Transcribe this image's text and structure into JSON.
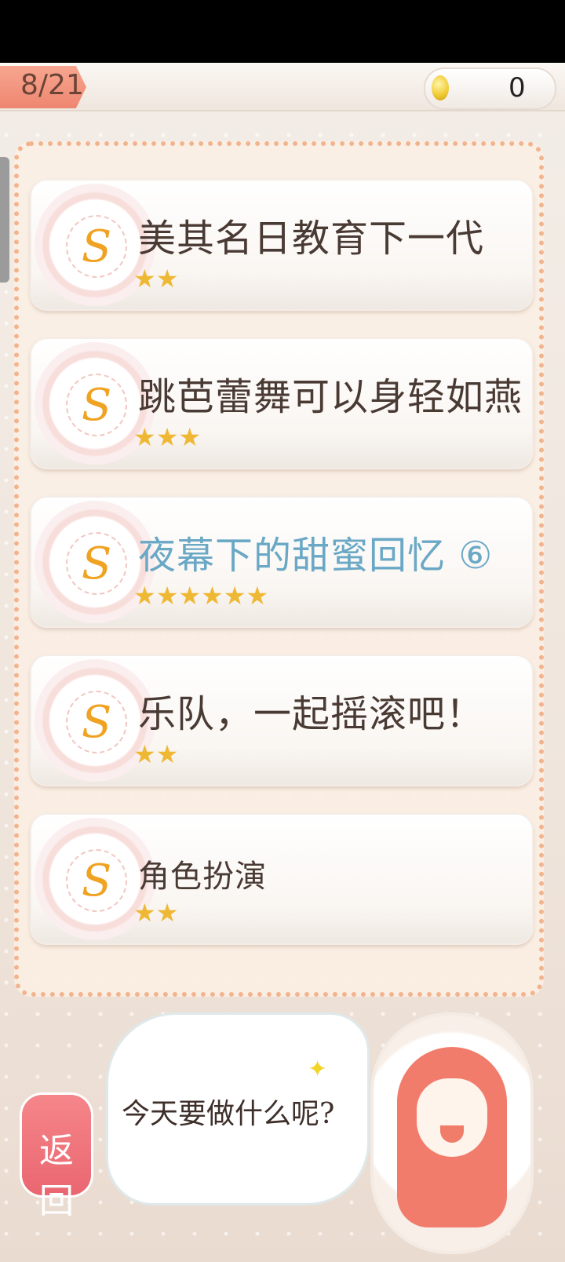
{
  "header": {
    "progress": "8/21",
    "coins": "0"
  },
  "items": [
    {
      "title": "美其名日教育下一代",
      "stars": "★★",
      "star_count": 2
    },
    {
      "title": "跳芭蕾舞可以身轻如燕",
      "stars": "★★★",
      "star_count": 3
    },
    {
      "title": "夜幕下的甜蜜回忆 ⑥",
      "stars": "★★★★★★",
      "star_count": 6
    },
    {
      "title": "乐队，一起摇滚吧！",
      "stars": "★★",
      "star_count": 2
    },
    {
      "title": "角色扮演",
      "stars": "★★",
      "star_count": 2
    }
  ],
  "dialog": {
    "text": "今天要做什么呢?"
  },
  "back_button": {
    "label": "返回"
  },
  "icons": {
    "badge": "swirl-s-icon",
    "coin": "coin-icon",
    "sparkle": "star-sparkle-icon"
  },
  "colors": {
    "accent": "#f08a76",
    "active_title": "#6aa8c6",
    "star": "#efb834",
    "back_button": "#ea6670"
  }
}
